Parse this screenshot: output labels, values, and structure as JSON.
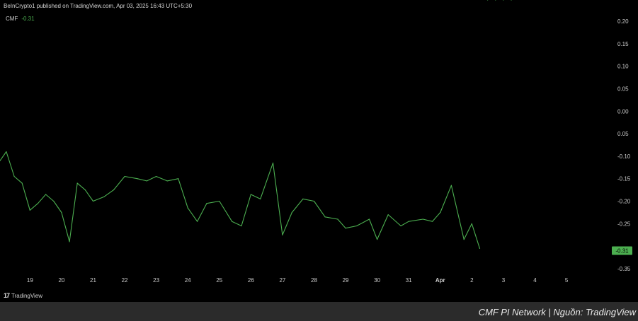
{
  "header": {
    "publisher_text": "BeInCrypto1 published on TradingView.com, Apr 03, 2025 16:43 UTC+5:30"
  },
  "legend": {
    "indicator": "CMF",
    "value": "-0.31"
  },
  "branding": {
    "logo_text": "TradingView",
    "logo_mark": "17"
  },
  "caption": "CMF PI Network | Nguồn: TradingView",
  "colors": {
    "background": "#000000",
    "line": "#4caf50",
    "last_value_badge": "#4caf50",
    "caption_bar": "#2b2b2b"
  },
  "chart_data": {
    "type": "line",
    "title": "",
    "series": [
      {
        "name": "CMF",
        "x": [
          18.0,
          18.25,
          18.5,
          18.75,
          19.0,
          19.25,
          19.5,
          19.75,
          20.0,
          20.25,
          20.5,
          20.75,
          21.0,
          21.35,
          21.65,
          22.0,
          22.4,
          22.7,
          23.0,
          23.35,
          23.7,
          24.0,
          24.3,
          24.6,
          25.0,
          25.4,
          25.7,
          26.0,
          26.3,
          26.7,
          27.0,
          27.3,
          27.65,
          28.0,
          28.35,
          28.75,
          29.0,
          29.35,
          29.75,
          30.0,
          30.35,
          30.75,
          31.0,
          31.45,
          31.75,
          32.0,
          32.35,
          32.75,
          33.0,
          33.25,
          33.5,
          33.75,
          34.0,
          34.25
        ]
      }
    ],
    "x_tick_labels": [
      "19",
      "20",
      "21",
      "22",
      "23",
      "24",
      "25",
      "26",
      "27",
      "28",
      "29",
      "30",
      "31",
      "Apr",
      "2",
      "3",
      "4",
      "5"
    ],
    "x_tick_positions": [
      19,
      20,
      21,
      22,
      23,
      24,
      25,
      26,
      27,
      28,
      29,
      30,
      31,
      32,
      33,
      34,
      35,
      36
    ],
    "y_ticks": [
      0.2,
      0.15,
      0.1,
      0.05,
      0.0,
      -0.05,
      -0.1,
      -0.15,
      -0.2,
      -0.25,
      -0.35
    ],
    "y_tick_labels": [
      "0.20",
      "0.15",
      "0.10",
      "0.05",
      "0.00",
      "0.05",
      "-0.10",
      "-0.15",
      "-0.20",
      "-0.25",
      "-0.35"
    ],
    "ylim": [
      -0.365,
      0.22
    ],
    "xlim": [
      18.05,
      37.3
    ],
    "last_value_label": "-0.31",
    "grid": false,
    "y_values": [
      -0.115,
      -0.09,
      -0.145,
      -0.16,
      -0.22,
      -0.205,
      -0.185,
      -0.2,
      -0.225,
      -0.29,
      -0.16,
      -0.175,
      -0.2,
      -0.19,
      -0.175,
      -0.145,
      -0.15,
      -0.155,
      -0.145,
      -0.155,
      -0.15,
      -0.215,
      -0.245,
      -0.205,
      -0.2,
      -0.245,
      -0.255,
      -0.185,
      -0.195,
      -0.115,
      -0.275,
      -0.225,
      -0.195,
      -0.2,
      -0.235,
      -0.24,
      -0.26,
      -0.255,
      -0.24,
      -0.285,
      -0.23,
      -0.255,
      -0.245,
      -0.24,
      -0.245,
      -0.225,
      -0.165,
      -0.285,
      -0.25,
      -0.305
    ]
  }
}
